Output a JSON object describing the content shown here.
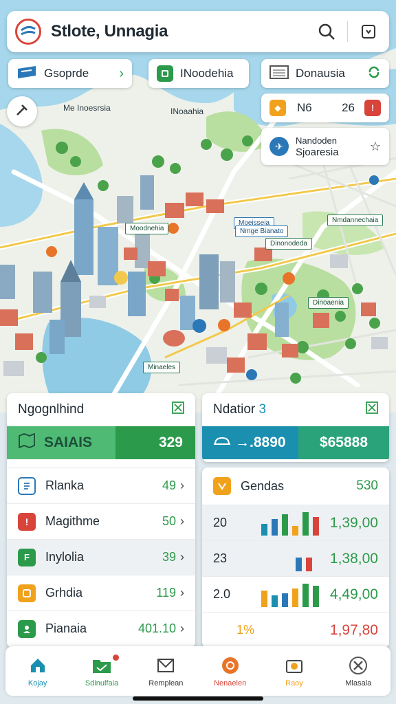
{
  "header": {
    "title": "Stlote, Unnagia"
  },
  "chips": {
    "left": {
      "label": "Gsoprde"
    },
    "middle": {
      "label": "INoodehia"
    },
    "right": {
      "label": "Donausia"
    }
  },
  "floating": {
    "stat": {
      "label": "N6",
      "value": "26"
    },
    "info": {
      "line1": "Nandoden",
      "line2": "Sjoaresia"
    }
  },
  "map": {
    "labels": [
      "Me Inoesrsia",
      "INoaahia"
    ],
    "tags": [
      "Moodnehia",
      "Moeisseia",
      "Nmge Bianato",
      "Dinonodeda",
      "Nmdannechaia",
      "Dinoaenia",
      "Minaeles"
    ]
  },
  "left_panel": {
    "title": "Ngognlhind",
    "banner_label": "SAIAIS",
    "banner_value": "329",
    "rows": [
      {
        "label": "Rlanka",
        "value": "49",
        "icon": "document-icon",
        "color": "#2b78b8"
      },
      {
        "label": "Magithme",
        "value": "50",
        "icon": "alert-icon",
        "color": "#d8443a"
      },
      {
        "label": "Inylolia",
        "value": "39",
        "icon": "box-icon",
        "color": "#2c9a4b"
      },
      {
        "label": "Grhdia",
        "value": "119",
        "icon": "coin-icon",
        "color": "#f0a21d"
      },
      {
        "label": "Pianaia",
        "value": "401.10",
        "icon": "user-icon",
        "color": "#2c9a4b"
      }
    ]
  },
  "right_panel": {
    "title": "Ndatior",
    "title_num": "3",
    "banner_label": "→.8890",
    "banner_value": "$65888",
    "summary": {
      "label": "Gendas",
      "value": "530"
    },
    "rows": [
      {
        "left": "20",
        "value": "1,39,00"
      },
      {
        "left": "23",
        "value": "1,38,00"
      },
      {
        "left": "2.0",
        "value": "4,49,00"
      },
      {
        "left": "1%",
        "value": "1,97,80"
      }
    ]
  },
  "bottom_nav": [
    {
      "label": "Kojay",
      "icon": "home-icon",
      "color": "#1a8fb0"
    },
    {
      "label": "Sdinulfaia",
      "icon": "folder-icon",
      "color": "#2c9a4b"
    },
    {
      "label": "Remplean",
      "icon": "inbox-icon",
      "color": "#444444"
    },
    {
      "label": "Nenaelen",
      "icon": "circle-icon",
      "color": "#e8742a"
    },
    {
      "label": "Raoy",
      "icon": "camera-icon",
      "color": "#f0a21d"
    },
    {
      "label": "Mlasala",
      "icon": "tools-icon",
      "color": "#555555"
    }
  ],
  "colors": {
    "accent_green": "#2c9a4b",
    "accent_blue": "#1a8fb0",
    "brand_red": "#d8443a"
  }
}
